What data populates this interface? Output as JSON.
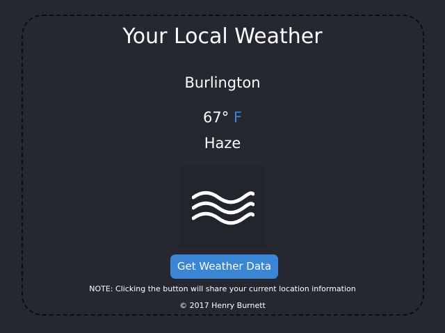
{
  "header": {
    "title": "Your Local Weather"
  },
  "weather": {
    "location": "Burlington",
    "temperature": "67°",
    "unit": "F",
    "condition": "Haze",
    "icon": "haze-waves-icon"
  },
  "actions": {
    "get_weather_label": "Get Weather Data"
  },
  "footer": {
    "note": "NOTE: Clicking the button will share your current location information",
    "copyright": "© 2017 Henry Burnett"
  },
  "colors": {
    "background": "#252831",
    "accent": "#3a86d4",
    "text": "#ffffff"
  }
}
